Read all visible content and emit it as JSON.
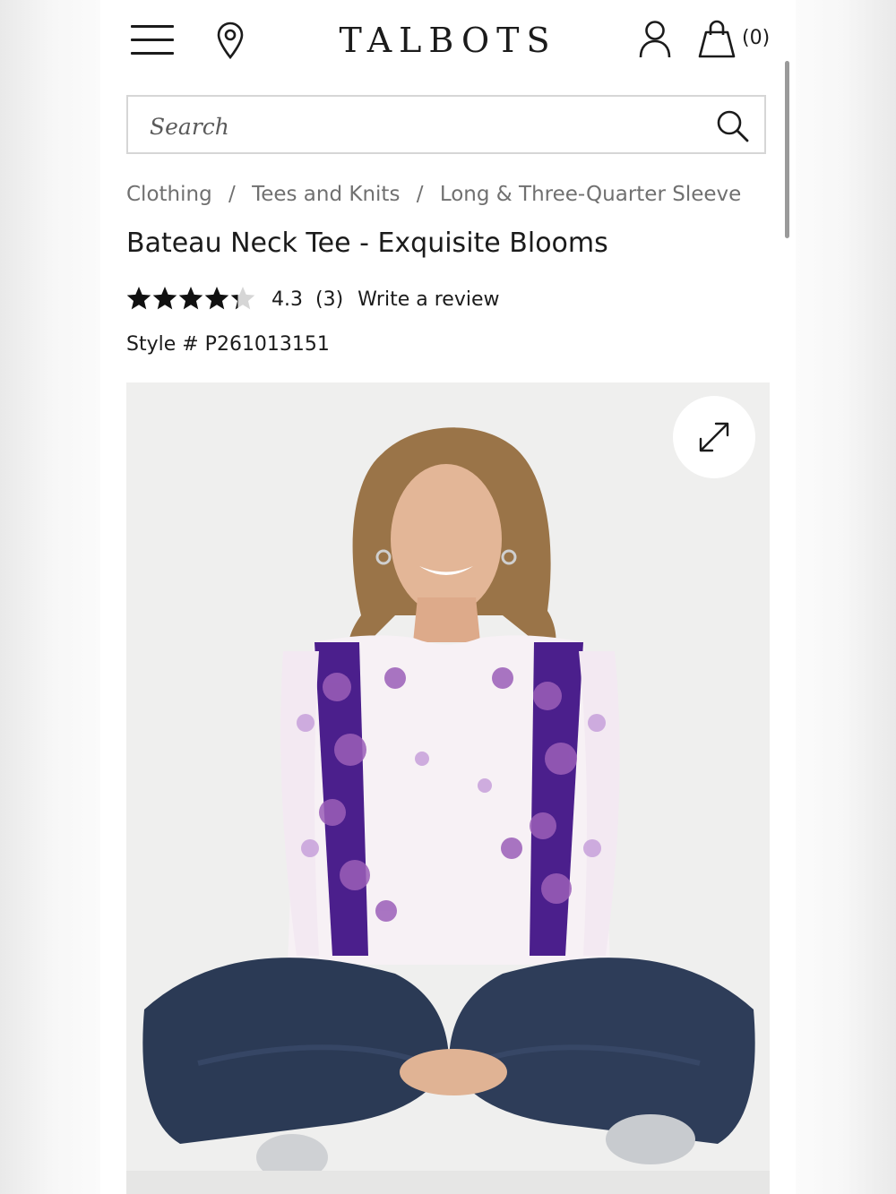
{
  "header": {
    "logo": "TALBOTS",
    "bag_count": "(0)",
    "icons": [
      "menu-icon",
      "location-pin-icon",
      "account-icon",
      "shopping-bag-icon"
    ]
  },
  "search": {
    "placeholder": "Search",
    "value": ""
  },
  "breadcrumb": [
    "Clothing",
    "Tees and Knits",
    "Long & Three-Quarter Sleeve"
  ],
  "breadcrumb_separator": "/",
  "product": {
    "title": "Bateau Neck Tee - Exquisite Blooms",
    "rating": "4.3",
    "rating_value": 4.3,
    "rating_max": 5,
    "review_count": "(3)",
    "write_review": "Write a review",
    "style_number": "Style # P261013151"
  },
  "colors": {
    "text": "#1b1b1b",
    "muted": "#707070",
    "image_bg": "#efefee",
    "blouse_purple": "#4b1f8c",
    "denim": "#2b3a55"
  }
}
